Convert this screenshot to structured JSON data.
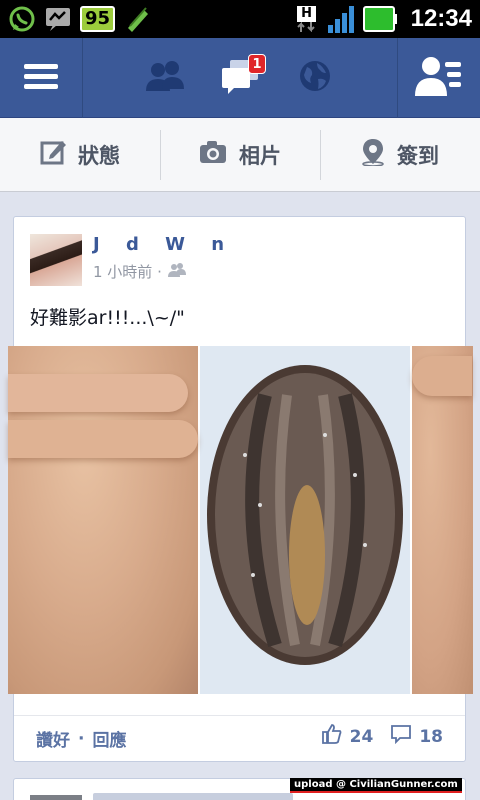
{
  "statusbar": {
    "battery": "95",
    "network": "H",
    "time": "12:34",
    "icons": [
      "whatsapp-icon",
      "messenger-icon",
      "battery-percent",
      "pencil-icon",
      "network-h-icon",
      "signal-icon",
      "battery-icon"
    ]
  },
  "navbar": {
    "menu_icon": "menu-icon",
    "friends_icon": "friend-requests-icon",
    "messages_icon": "messages-icon",
    "messages_badge": "1",
    "globe_icon": "notifications-globe-icon",
    "profile_icon": "profile-list-icon"
  },
  "publisher": {
    "status_label": "狀態",
    "photo_label": "相片",
    "checkin_label": "簽到"
  },
  "post": {
    "author": "J d W n",
    "time": "1 小時前 ·",
    "audience_icon": "friends-audience-icon",
    "text": "好難影ar!!!...\\~/\"",
    "like_action": "讚好",
    "separator": "·",
    "comment_action": "回應",
    "likes": "24",
    "comments": "18"
  },
  "watermark": "upload @ CivilianGunner.com",
  "colors": {
    "fb_blue": "#3b5998",
    "badge_red": "#e0262a",
    "link_blue": "#5b73a4"
  }
}
